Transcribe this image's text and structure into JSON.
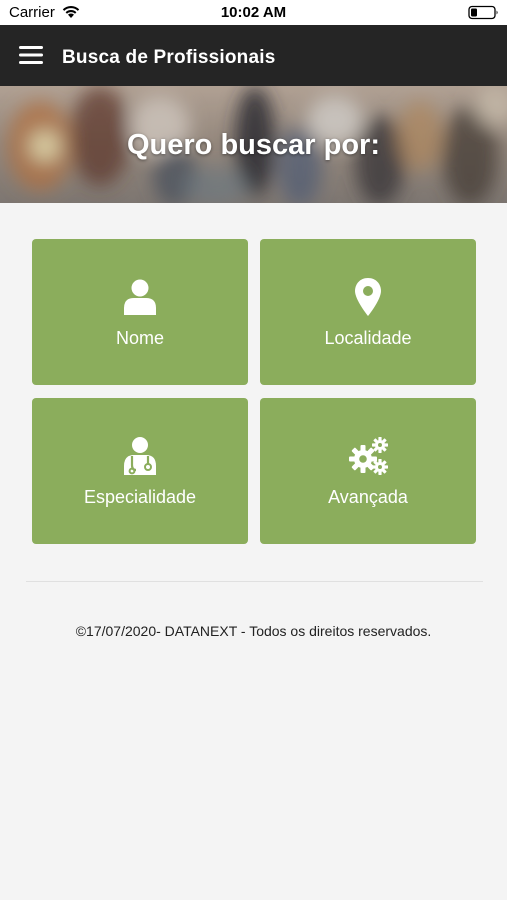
{
  "status_bar": {
    "carrier": "Carrier",
    "time": "10:02 AM",
    "icons": [
      "wifi-icon",
      "battery-icon"
    ]
  },
  "app_bar": {
    "title": "Busca de Profissionais",
    "menu_icon": "hamburger-menu-icon"
  },
  "hero": {
    "title": "Quero buscar por:"
  },
  "tiles": [
    {
      "label": "Nome",
      "icon": "person-icon"
    },
    {
      "label": "Localidade",
      "icon": "map-pin-icon"
    },
    {
      "label": "Especialidade",
      "icon": "doctor-icon"
    },
    {
      "label": "Avançada",
      "icon": "gears-icon"
    }
  ],
  "footer": {
    "text": "©17/07/2020- DATANEXT - Todos os direitos reservados."
  },
  "colors": {
    "app_bar": "#252525",
    "tile": "#8bad5c",
    "background": "#f4f4f4"
  }
}
